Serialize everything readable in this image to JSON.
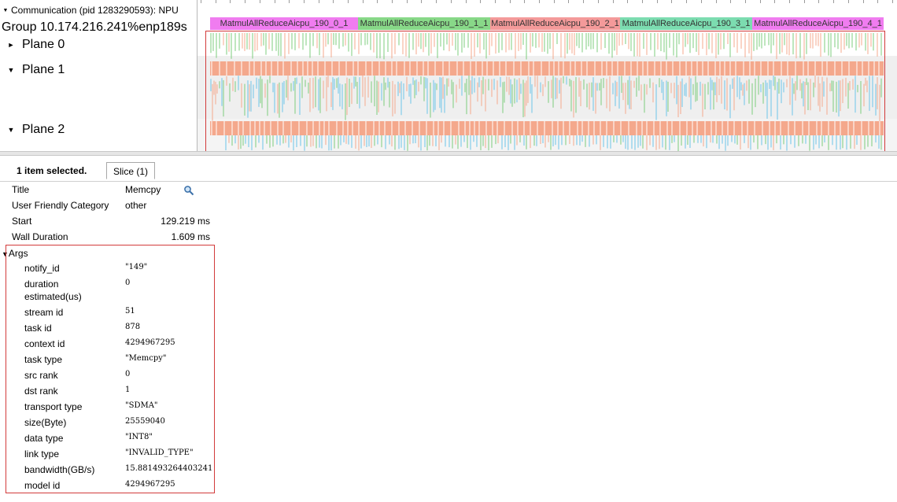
{
  "process_header": "Communication (pid 1283290593): NPU",
  "group_label": "Group 10.174.216.241%enp189s",
  "planes": [
    "Plane 0",
    "Plane 1",
    "Plane 2"
  ],
  "slices": [
    {
      "label": "MatmulAllReduceAicpu_190_0_1",
      "color": "#f07cf0"
    },
    {
      "label": "MatmulAllReduceAicpu_190_1_1",
      "color": "#88d888"
    },
    {
      "label": "MatmulAllReduceAicpu_190_2_1",
      "color": "#f49a9a"
    },
    {
      "label": "MatmulAllReduceAicpu_190_3_1",
      "color": "#7cdcb0"
    },
    {
      "label": "MatmulAllReduceAicpu_190_4_1",
      "color": "#f07cf0"
    }
  ],
  "colors": {
    "memcpy_salmon": "#f4a88c",
    "green_mark": "#7ccc7c",
    "blue_mark": "#6cc4e8",
    "red_highlight": "#d23a3a"
  },
  "selection": {
    "summary": "1 item selected.",
    "tab": "Slice (1)"
  },
  "details": {
    "title_label": "Title",
    "title_value": "Memcpy",
    "category_label": "User Friendly Category",
    "category_value": "other",
    "start_label": "Start",
    "start_value": "129.219 ms",
    "duration_label": "Wall Duration",
    "duration_value": "1.609 ms",
    "args_label": "Args",
    "search_icon": "magnifier-icon"
  },
  "args": [
    {
      "label": "notify_id",
      "value": "\"149\""
    },
    {
      "label": "duration estimated(us)",
      "value": "0"
    },
    {
      "label": "stream id",
      "value": "51"
    },
    {
      "label": "task id",
      "value": "878"
    },
    {
      "label": "context id",
      "value": "4294967295"
    },
    {
      "label": "task type",
      "value": "\"Memcpy\""
    },
    {
      "label": "src rank",
      "value": "0"
    },
    {
      "label": "dst rank",
      "value": "1"
    },
    {
      "label": "transport type",
      "value": "\"SDMA\""
    },
    {
      "label": "size(Byte)",
      "value": "25559040"
    },
    {
      "label": "data type",
      "value": "\"INT8\""
    },
    {
      "label": "link type",
      "value": "\"INVALID_TYPE\""
    },
    {
      "label": "bandwidth(GB/s)",
      "value": "15.881493264403241"
    },
    {
      "label": "model id",
      "value": "4294967295"
    }
  ]
}
